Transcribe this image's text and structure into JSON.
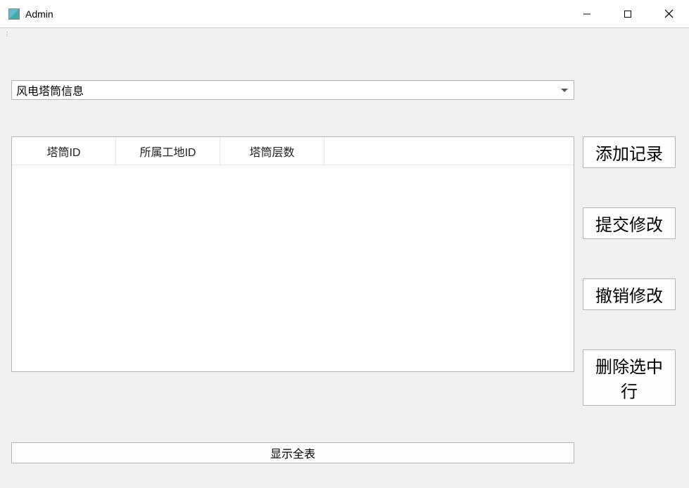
{
  "window": {
    "title": "Admin"
  },
  "dropdown": {
    "selected": "风电塔筒信息"
  },
  "table": {
    "columns": [
      "塔筒ID",
      "所属工地ID",
      "塔筒层数"
    ],
    "rows": []
  },
  "side_buttons": {
    "add": "添加记录",
    "commit": "提交修改",
    "revert": "撤销修改",
    "delete": "删除选中行"
  },
  "bottom_button": {
    "label": "显示全表"
  }
}
